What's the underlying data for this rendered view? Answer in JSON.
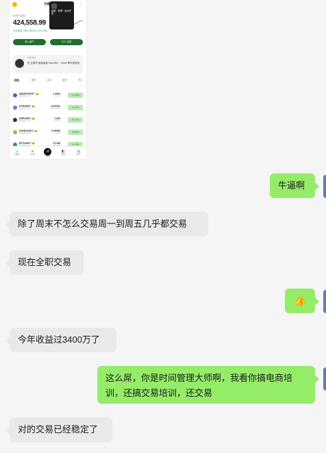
{
  "screenshot": {
    "app_title": "交易所",
    "total_label": "总资产估值",
    "balance": "424,558.99",
    "pnl_text": "今日收益 +$81,288.51 (+24.23%)",
    "popup_text": "最新 · 获得 · 活动详情",
    "btn_left": "转入资产",
    "btn_right": "C2C 交易",
    "news_title": "最新活动",
    "news_text": "在 交易所 使用赢取 Mac Mini、Token 等丰富奖品",
    "tabs": [
      "自选",
      "现货",
      "合约",
      "新币",
      "热门"
    ],
    "coins": [
      {
        "name": "WAVESUSDT",
        "tag": "3X",
        "sub": "成交额 2.3M",
        "price": "1.4942",
        "price_sub": "$1.49",
        "change": "+13.95%",
        "color": "#2d6be4"
      },
      {
        "name": "ETHUSDT",
        "tag": "5X",
        "sub": "成交额 4.1B",
        "price": "2,325.81",
        "price_sub": "$2,325.81",
        "change": "+6.67%",
        "color": "#6b7bd8"
      },
      {
        "name": "XRPUSDT",
        "tag": "5X",
        "sub": "成交额 1.2B",
        "price": "1.443",
        "price_sub": "$1.44",
        "change": "+5.77%",
        "color": "#333333"
      },
      {
        "name": "DOGEUSDT",
        "tag": "5X",
        "sub": "成交额 980M",
        "price": "0.09953",
        "price_sub": "$0.10",
        "change": "+5.69%",
        "color": "#c8a43a"
      },
      {
        "name": "BTCUSDT",
        "tag": "5X",
        "sub": "成交额 8.6B",
        "price": "74,338",
        "price_sub": "$74,338",
        "change": "+4.10%",
        "color": "#3a7bd5"
      }
    ],
    "nav": [
      {
        "label": "首页",
        "glyph": "⌂"
      },
      {
        "label": "行情",
        "glyph": "≡"
      },
      {
        "label": "交易",
        "glyph": "⇄"
      },
      {
        "label": "合约",
        "glyph": "◧"
      },
      {
        "label": "资产",
        "glyph": "◎"
      }
    ]
  },
  "messages": [
    {
      "side": "right",
      "text": "牛逼啊"
    },
    {
      "side": "left",
      "text": "除了周末不怎么交易周一到周五几乎都交易"
    },
    {
      "side": "left",
      "text": "现在全职交易"
    },
    {
      "side": "right",
      "text": "👍"
    },
    {
      "side": "left",
      "text": "今年收益过3400万了"
    },
    {
      "side": "right",
      "text": "这么屌，你是时间管理大师啊，我看你搞电商培训，还搞交易培训，还交易"
    },
    {
      "side": "left",
      "text": "对的交易已经稳定了"
    }
  ]
}
